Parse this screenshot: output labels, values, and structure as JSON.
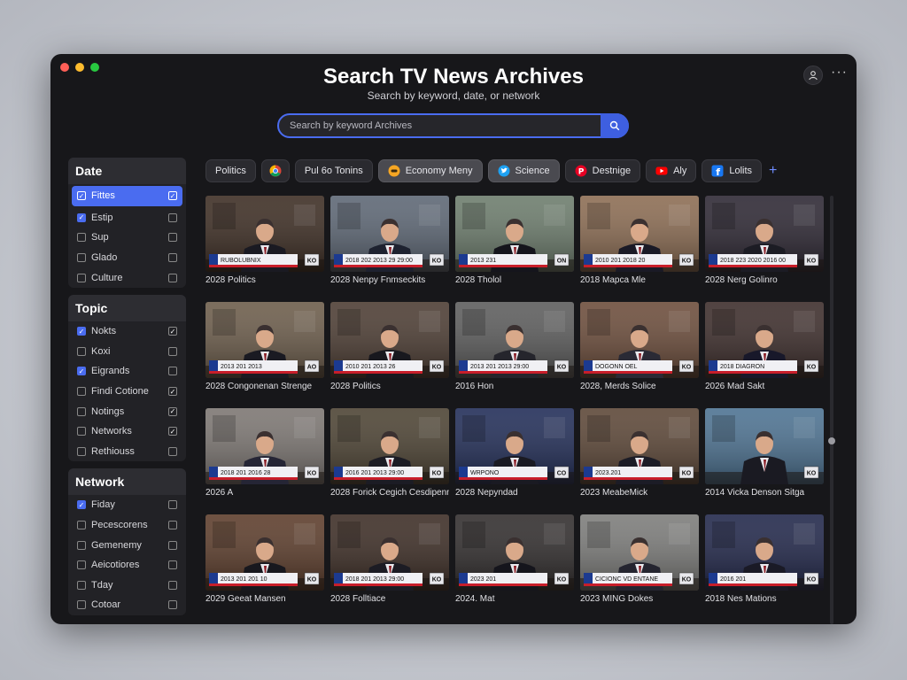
{
  "header": {
    "title": "Search TV News Archives",
    "subtitle": "Search by keyword, date, or network"
  },
  "search": {
    "placeholder": "Search by keyword Archives",
    "value": ""
  },
  "sidebar": {
    "sections": [
      {
        "title": "Date",
        "items": [
          {
            "label": "Fittes",
            "left": true,
            "right": true,
            "active": true
          },
          {
            "label": "Estip",
            "left": true,
            "right": false
          },
          {
            "label": "Sup",
            "left": false,
            "right": false
          },
          {
            "label": "Glado",
            "left": false,
            "right": false
          },
          {
            "label": "Culture",
            "left": false,
            "right": false
          }
        ]
      },
      {
        "title": "Topic",
        "items": [
          {
            "label": "Nokts",
            "left": true,
            "right": true
          },
          {
            "label": "Koxi",
            "left": false,
            "right": false
          },
          {
            "label": "Eigrands",
            "left": true,
            "right": false
          },
          {
            "label": "Findi Cotione",
            "left": false,
            "right": true
          },
          {
            "label": "Notings",
            "left": false,
            "right": true
          },
          {
            "label": "Networks",
            "left": false,
            "right": true
          },
          {
            "label": "Rethiouss",
            "left": false,
            "right": false
          }
        ]
      },
      {
        "title": "Network",
        "items": [
          {
            "label": "Fiday",
            "left": true,
            "right": false
          },
          {
            "label": "Pecescorens",
            "left": false,
            "right": false
          },
          {
            "label": "Gemenemy",
            "left": false,
            "right": false
          },
          {
            "label": "Aeicotiores",
            "left": false,
            "right": false
          },
          {
            "label": "Tday",
            "left": false,
            "right": false
          },
          {
            "label": "Cotoar",
            "left": false,
            "right": false
          }
        ]
      }
    ]
  },
  "chips": [
    {
      "label": "Politics",
      "icon": "none"
    },
    {
      "label": "",
      "icon": "chrome-icon"
    },
    {
      "label": "Pul 6o Tonins",
      "icon": "none"
    },
    {
      "label": "Economy Meny",
      "icon": "eye-icon",
      "selected": true
    },
    {
      "label": "Science",
      "icon": "twitter-icon",
      "selected": true
    },
    {
      "label": "Destnige",
      "icon": "pinterest-icon"
    },
    {
      "label": "Aly",
      "icon": "youtube-icon"
    },
    {
      "label": "Lolits",
      "icon": "facebook-icon"
    }
  ],
  "videos": [
    {
      "caption": "2028 Politics",
      "ticker": "RUBOLUBNIX",
      "badge": "KO",
      "bg": "#3a2a20",
      "suit": "#1a1a22"
    },
    {
      "caption": "2028 Nenpy Fnmseckits",
      "ticker": "2018 202 2013 29 29:00",
      "badge": "KO",
      "bg": "#5a6472",
      "suit": "#1e2230"
    },
    {
      "caption": "2028 Tholol",
      "ticker": "2013 231",
      "badge": "ON",
      "bg": "#6a7a6a",
      "suit": "#15151c"
    },
    {
      "caption": "2018 Mapca Mle",
      "ticker": "2010 201 2018 20",
      "badge": "KO",
      "bg": "#8a6a50",
      "suit": "#1a1a26"
    },
    {
      "caption": "2028 Nerg Golinro",
      "ticker": "2018 223 2020 2016 00",
      "badge": "KO",
      "bg": "#2a2430",
      "suit": "#1c1c24"
    },
    {
      "caption": "2028 Congonenan Strenge",
      "ticker": "2013 201 2013",
      "badge": "AO",
      "bg": "#6a5a48",
      "suit": "#1a1a22"
    },
    {
      "caption": "2028 Politics",
      "ticker": "2010 201 2013 26",
      "badge": "KO",
      "bg": "#4a3a30",
      "suit": "#18181e"
    },
    {
      "caption": "2016 Hon",
      "ticker": "2013 201 2013 29:00",
      "badge": "KO",
      "bg": "#5a5a5a",
      "suit": "#25252c"
    },
    {
      "caption": "2028, Merds Solice",
      "ticker": "DOGONN OEL",
      "badge": "KO",
      "bg": "#6a4a38",
      "suit": "#2a2a35"
    },
    {
      "caption": "2026 Mad Sakt",
      "ticker": "2018 DIAGRON",
      "badge": "KO",
      "bg": "#3a2a28",
      "suit": "#18182a"
    },
    {
      "caption": "2026 A",
      "ticker": "2018 201 2016 28",
      "badge": "KO",
      "bg": "#7a7470",
      "suit": "#252535"
    },
    {
      "caption": "2028 Forick Cegich Cesdipenn",
      "ticker": "2016 201 2013 29:00",
      "badge": "KO",
      "bg": "#4a4030",
      "suit": "#1c1c24"
    },
    {
      "caption": "2028 Nepyndad",
      "ticker": "WRPONO",
      "badge": "CO",
      "bg": "#1e2a55",
      "suit": "#1a1a22"
    },
    {
      "caption": "2023 MeabeMick",
      "ticker": "2023.201",
      "badge": "KO",
      "bg": "#5a4434",
      "suit": "#1c1c26"
    },
    {
      "caption": "2014 Vicka Denson Sitga",
      "ticker": "",
      "badge": "KO",
      "bg": "#4a7090",
      "suit": "#1a1a22"
    },
    {
      "caption": "2029 Geeat Mansen",
      "ticker": "2013 201 201 10",
      "badge": "KO",
      "bg": "#5a3a28",
      "suit": "#18181e"
    },
    {
      "caption": "2028 Folltiace",
      "ticker": "2018 201 2013 29:00",
      "badge": "KO",
      "bg": "#3a2a22",
      "suit": "#1c1c24"
    },
    {
      "caption": "2024. Mat",
      "ticker": "2023 201",
      "badge": "KO",
      "bg": "#2e2a2a",
      "suit": "#15151c"
    },
    {
      "caption": "2023 MING Dokes",
      "ticker": "CICIONC VD ENTANE",
      "badge": "KO",
      "bg": "#7a7a78",
      "suit": "#252530"
    },
    {
      "caption": "2018 Nes Mations",
      "ticker": "2016 201",
      "badge": "KO",
      "bg": "#1e2448",
      "suit": "#1a1a26"
    }
  ],
  "colors": {
    "accent": "#4a6cf0",
    "window_bg": "#17171a",
    "panel_bg": "#222226"
  }
}
